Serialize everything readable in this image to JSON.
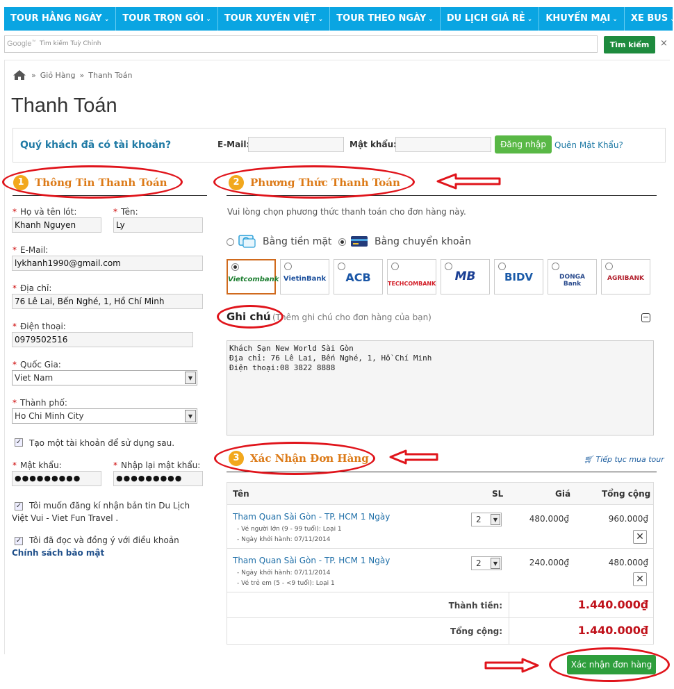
{
  "nav": {
    "items": [
      "TOUR HẰNG NGÀY",
      "TOUR TRỌN GÓI",
      "TOUR XUYÊN VIỆT",
      "TOUR THEO NGÀY",
      "DU LỊCH GIÁ RẺ",
      "KHUYẾN MẠI",
      "XE BUS"
    ]
  },
  "search": {
    "logo": "Google",
    "placeholder": "Tìm kiếm Tuỳ Chỉnh",
    "button": "Tìm kiếm",
    "close": "×"
  },
  "breadcrumb": [
    "Giỏ Hàng",
    "Thanh Toán"
  ],
  "page_title": "Thanh Toán",
  "login": {
    "question": "Quý khách đã có tài khoản?",
    "email_label": "E-Mail:",
    "password_label": "Mật khẩu:",
    "login_button": "Đăng nhập",
    "forgot": "Quên Mật Khẩu?"
  },
  "section1": {
    "num": "1",
    "title": "Thông Tin Thanh Toán"
  },
  "section2": {
    "num": "2",
    "title": "Phương Thức Thanh Toán"
  },
  "section3": {
    "num": "3",
    "title": "Xác Nhận Đơn Hàng"
  },
  "form": {
    "lastname_label": "Họ và tên lót:",
    "lastname": "Khanh Nguyen",
    "firstname_label": "Tên:",
    "firstname": "Ly",
    "email_label": "E-Mail:",
    "email": "lykhanh1990@gmail.com",
    "address_label": "Địa chỉ:",
    "address": "76 Lê Lai, Bến Nghé, 1, Hồ Chí Minh",
    "phone_label": "Điện thoại:",
    "phone": "0979502516",
    "country_label": "Quốc Gia:",
    "country": "Viet Nam",
    "city_label": "Thành phố:",
    "city": "Ho Chi Minh City",
    "create_account": "Tạo một tài khoản để sử dụng sau.",
    "password_label": "Mật khẩu:",
    "password": "●●●●●●●●●",
    "repassword_label": "Nhập lại mật khẩu:",
    "repassword": "●●●●●●●●●",
    "newsletter": "Tôi muốn đăng kí nhận bản tin Du Lịch Việt Vui - Viet Fun Travel .",
    "terms_prefix": "Tôi đã đọc và đồng ý với điều khoản",
    "terms_link": "Chính sách bảo mật"
  },
  "payment": {
    "intro": "Vui lòng chọn phương thức thanh toán cho đơn hàng này.",
    "cash": "Bằng tiền mặt",
    "transfer": "Bằng chuyển khoản",
    "banks": [
      {
        "name": "Vietcombank",
        "color": "#1a7d2e"
      },
      {
        "name": "VietinBank",
        "color": "#1b4f9c"
      },
      {
        "name": "ACB",
        "color": "#1a56a6"
      },
      {
        "name": "TECHCOMBANK",
        "color": "#d3202a"
      },
      {
        "name": "MB",
        "color": "#1b3f94"
      },
      {
        "name": "BIDV",
        "color": "#1a5aa8"
      },
      {
        "name": "DONGA Bank",
        "color": "#2a4b8d"
      },
      {
        "name": "AGRIBANK",
        "color": "#b2202d"
      }
    ]
  },
  "note": {
    "title": "Ghi chú",
    "subtitle": "(Thêm ghi chú cho đơn hàng của bạn)",
    "text": "Khách Sạn New World Sài Gòn\nĐịa chỉ: 76 Lê Lai, Bến Nghé, 1, Hồ Chí Minh\nĐiện thoại:08 3822 8888"
  },
  "order": {
    "continue": "Tiếp tục mua tour",
    "headers": {
      "name": "Tên",
      "qty": "SL",
      "price": "Giá",
      "total": "Tổng cộng"
    },
    "items": [
      {
        "name": "Tham Quan Sài Gòn - TP. HCM 1 Ngày",
        "lines": [
          "- Vé người lớn (9 - 99 tuổi): Loại 1",
          "- Ngày khởi hành: 07/11/2014"
        ],
        "qty": "2",
        "price": "480.000₫",
        "total": "960.000₫"
      },
      {
        "name": "Tham Quan Sài Gòn - TP. HCM 1 Ngày",
        "lines": [
          "- Ngày khởi hành: 07/11/2014",
          "- Vé trẻ em (5 - <9 tuổi): Loại 1"
        ],
        "qty": "2",
        "price": "240.000₫",
        "total": "480.000₫"
      }
    ],
    "subtotal_label": "Thành tiền:",
    "subtotal": "1.440.000₫",
    "grand_label": "Tổng cộng:",
    "grand": "1.440.000₫"
  },
  "confirm_button": "Xác nhận đơn hàng"
}
